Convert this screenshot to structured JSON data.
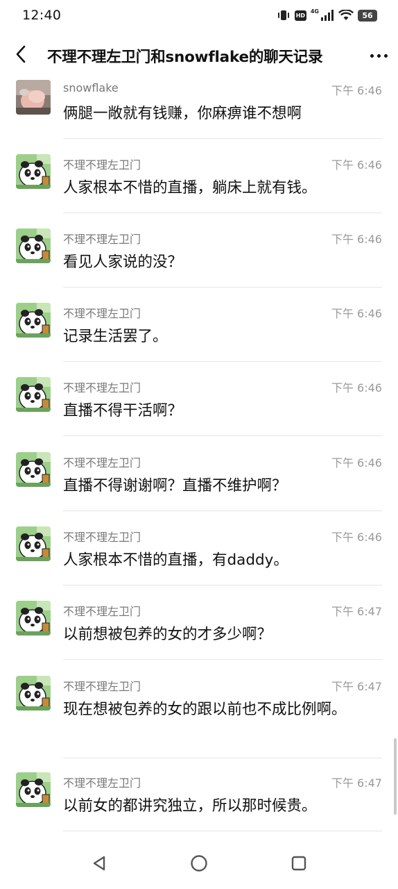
{
  "status_bar": {
    "time": "12:40",
    "hd_label": "HD",
    "network_label": "4G",
    "battery": "56",
    "icons": [
      "vibrate-icon",
      "hd-icon",
      "signal-icon",
      "wifi-icon",
      "battery-icon"
    ]
  },
  "header": {
    "back_icon": "chevron-left-icon",
    "title": "不理不理左卫门和snowflake的聊天记录",
    "more_icon": "more-dots-icon"
  },
  "messages": [
    {
      "sender": "snowflake",
      "time": "下午 6:46",
      "text": "俩腿一敞就有钱赚，你麻痹谁不想啊",
      "avatar": "photo"
    },
    {
      "sender": "不理不理左卫门",
      "time": "下午 6:46",
      "text": "人家根本不惜的直播，躺床上就有钱。",
      "avatar": "panda"
    },
    {
      "sender": "不理不理左卫门",
      "time": "下午 6:46",
      "text": "看见人家说的没？",
      "avatar": "panda"
    },
    {
      "sender": "不理不理左卫门",
      "time": "下午 6:46",
      "text": "记录生活罢了。",
      "avatar": "panda"
    },
    {
      "sender": "不理不理左卫门",
      "time": "下午 6:46",
      "text": "直播不得干活啊？",
      "avatar": "panda"
    },
    {
      "sender": "不理不理左卫门",
      "time": "下午 6:46",
      "text": "直播不得谢谢啊？直播不维护啊？",
      "avatar": "panda"
    },
    {
      "sender": "不理不理左卫门",
      "time": "下午 6:46",
      "text": "人家根本不惜的直播，有daddy。",
      "avatar": "panda"
    },
    {
      "sender": "不理不理左卫门",
      "time": "下午 6:47",
      "text": "以前想被包养的女的才多少啊？",
      "avatar": "panda"
    },
    {
      "sender": "不理不理左卫门",
      "time": "下午 6:47",
      "text": "现在想被包养的女的跟以前也不成比例啊。",
      "avatar": "panda"
    },
    {
      "sender": "不理不理左卫门",
      "time": "下午 6:47",
      "text": "以前女的都讲究独立，所以那时候贵。",
      "avatar": "panda"
    }
  ],
  "nav_bar": {
    "icons": [
      "back-triangle-icon",
      "home-circle-icon",
      "recents-square-icon"
    ]
  },
  "colors": {
    "background": "#ffffff",
    "text_primary": "#111111",
    "text_secondary": "#777777",
    "timestamp": "#9a9a9a",
    "divider": "#e6e6e6",
    "avatar_panda_bg": "#9ccf8a"
  }
}
